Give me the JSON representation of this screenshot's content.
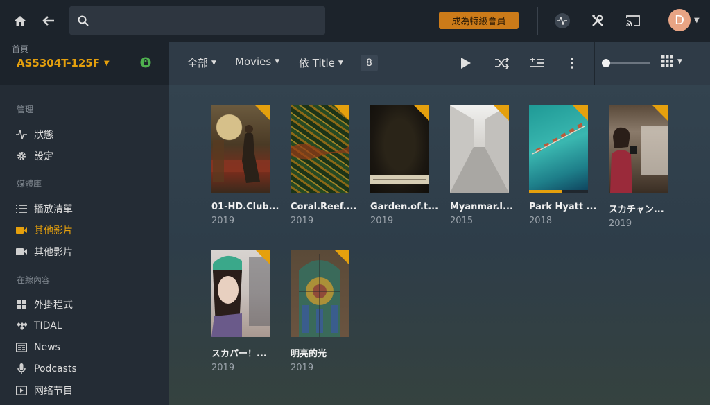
{
  "topbar": {
    "search_placeholder": "",
    "premium_label": "成為特級會員",
    "avatar_initial": "D"
  },
  "sidebar": {
    "home_label": "首頁",
    "server_name": "AS5304T-125F",
    "sections": {
      "manage": "管理",
      "library": "媒體庫",
      "online": "在線內容"
    },
    "manage_items": [
      {
        "label": "狀態",
        "icon": "activity-icon"
      },
      {
        "label": "設定",
        "icon": "gear-icon"
      }
    ],
    "library_items": [
      {
        "label": "播放清單",
        "icon": "list-icon"
      },
      {
        "label": "其他影片",
        "icon": "video-camera-icon",
        "active": true
      },
      {
        "label": "其他影片",
        "icon": "video-camera-icon"
      }
    ],
    "online_items": [
      {
        "label": "外掛程式",
        "icon": "grid-icon"
      },
      {
        "label": "TIDAL",
        "icon": "tidal-icon"
      },
      {
        "label": "News",
        "icon": "news-icon"
      },
      {
        "label": "Podcasts",
        "icon": "microphone-icon"
      },
      {
        "label": "网络节目",
        "icon": "play-box-icon"
      }
    ]
  },
  "toolbar": {
    "filter_all": "全部",
    "type_filter": "Movies",
    "sort_label": "依 Title",
    "count": "8",
    "slider_position": 0.0
  },
  "colors": {
    "accent": "#e5a00d",
    "premium": "#cc7b19",
    "topbar": "#1c232b",
    "sidebar": "#242c35"
  },
  "items": [
    {
      "title": "01-HD.Club...",
      "year": "2019"
    },
    {
      "title": "Coral.Reef....",
      "year": "2019"
    },
    {
      "title": "Garden.of.t...",
      "year": "2019"
    },
    {
      "title": "Myanmar.I...",
      "year": "2015"
    },
    {
      "title": "Park Hyatt ...",
      "year": "2018",
      "progress": 0.55
    },
    {
      "title": "スカチャン...",
      "year": "2019"
    },
    {
      "title": "スカパー！...",
      "year": "2019"
    },
    {
      "title": "明亮的光",
      "year": "2019"
    }
  ]
}
